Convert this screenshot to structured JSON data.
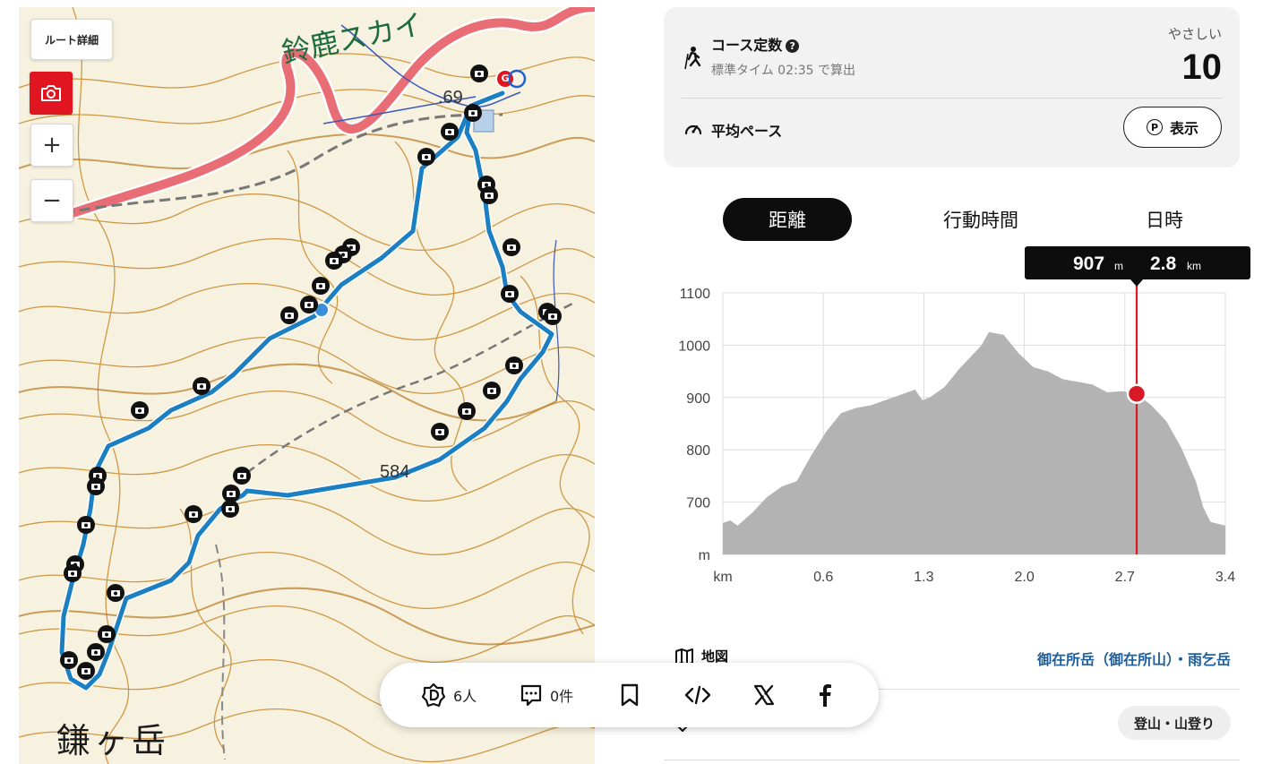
{
  "map": {
    "route_detail_label": "ルート詳細",
    "zoom_in_label": "+",
    "zoom_out_label": "−",
    "place_top": "鈴鹿スカイ",
    "place_bottom": "鎌ヶ岳",
    "elevation_labels": [
      ".69",
      "584"
    ],
    "goal_marker": "G",
    "colors": {
      "route": "#1c7fc2",
      "road": "#e96d75",
      "contour": "#c8892a",
      "base": "#f7f1df"
    }
  },
  "course": {
    "title": "コース定数",
    "help_icon": "question-icon",
    "subtitle": "標準タイム 02:35 で算出",
    "level": "やさしい",
    "score": "10",
    "pace_label": "平均ペース",
    "show_button": "表示",
    "show_badge": "P"
  },
  "tabs": [
    {
      "label": "距離",
      "active": true
    },
    {
      "label": "行動時間",
      "active": false
    },
    {
      "label": "日時",
      "active": false
    }
  ],
  "tooltip": {
    "elevation": "907",
    "elevation_unit": "m",
    "distance": "2.8",
    "distance_unit": "km"
  },
  "chart_data": {
    "type": "area",
    "x_unit": "km",
    "y_unit": "m",
    "x_ticks": [
      "km",
      "0.6",
      "1.3",
      "2.0",
      "2.7",
      "3.4"
    ],
    "y_ticks": [
      "1100",
      "1000",
      "900",
      "800",
      "700",
      "m"
    ],
    "ylim": [
      600,
      1100
    ],
    "xlim": [
      0,
      3.4
    ],
    "grid": true,
    "cursor_x": 2.8,
    "cursor_y": 907,
    "colors": {
      "fill": "#b3b3b3",
      "cursor": "#d81a27"
    },
    "x": [
      0,
      0.05,
      0.1,
      0.2,
      0.3,
      0.4,
      0.5,
      0.6,
      0.7,
      0.8,
      0.9,
      1.0,
      1.1,
      1.2,
      1.3,
      1.35,
      1.4,
      1.5,
      1.6,
      1.7,
      1.75,
      1.8,
      1.9,
      2.0,
      2.1,
      2.2,
      2.3,
      2.4,
      2.5,
      2.6,
      2.7,
      2.8,
      2.9,
      3.0,
      3.1,
      3.2,
      3.25,
      3.3,
      3.4
    ],
    "y": [
      660,
      665,
      655,
      680,
      710,
      730,
      740,
      790,
      835,
      870,
      880,
      885,
      895,
      905,
      915,
      895,
      900,
      920,
      955,
      985,
      1000,
      1025,
      1020,
      985,
      958,
      950,
      935,
      930,
      925,
      910,
      912,
      907,
      885,
      855,
      805,
      740,
      690,
      662,
      655
    ]
  },
  "rows": {
    "map_label": "地図",
    "map_link": "御在所岳（御在所山）・雨乞岳",
    "tag_pill": "登山・山登り"
  },
  "sharebar": {
    "people_count": "6人",
    "comment_count": "0件"
  }
}
